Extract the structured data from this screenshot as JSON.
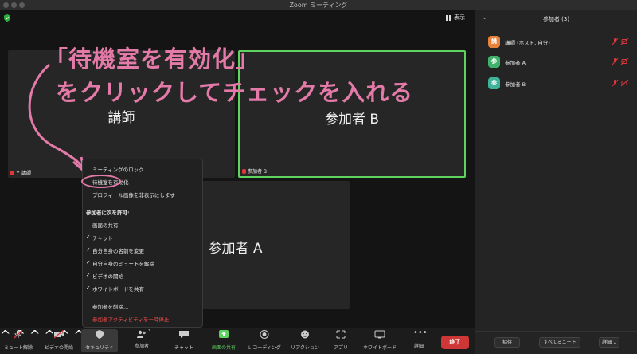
{
  "window": {
    "title": "Zoom ミーティング"
  },
  "main": {
    "view_label": "表示",
    "tiles": {
      "instructor": {
        "name": "講師",
        "label": "講師"
      },
      "participant_b": {
        "name": "参加者 B",
        "label": "参加者 B"
      },
      "participant_a": {
        "name": "参加者 A"
      }
    }
  },
  "annotation": {
    "line1": "「待機室を有効化」",
    "line2": "をクリックしてチェックを入れる",
    "color": "#e37aa8"
  },
  "security_menu": {
    "lock": "ミーティングのロック",
    "waiting_room": "待機室を有効化",
    "hide_profile": "プロフィール画像を非表示にします",
    "allow_heading": "参加者に次を許可:",
    "options": [
      {
        "label": "画面の共有",
        "checked": false
      },
      {
        "label": "チャット",
        "checked": true
      },
      {
        "label": "自分自身の名前を変更",
        "checked": true
      },
      {
        "label": "自分自身のミュートを解除",
        "checked": true
      },
      {
        "label": "ビデオの開始",
        "checked": true
      },
      {
        "label": "ホワイトボードを共有",
        "checked": true
      }
    ],
    "check_mark": "✓",
    "remove": "参加者を削除...",
    "suspend": "参加者アクティビティを一時停止"
  },
  "toolbar": {
    "unmute": "ミュート解除",
    "start_video": "ビデオの開始",
    "security": "セキュリティ",
    "participants": "参加者",
    "participants_count": "3",
    "chat": "チャット",
    "share": "画面の共有",
    "record": "レコーディング",
    "reactions": "リアクション",
    "apps": "アプリ",
    "whiteboard": "ホワイトボード",
    "more": "詳細",
    "end": "終了",
    "share_color": "#5fd35f",
    "end_color": "#cf3736"
  },
  "panel": {
    "title": "参加者 (3)",
    "participants": [
      {
        "avatar": "講",
        "name": "講師 (ホスト, 自分)",
        "color": "#e8823a"
      },
      {
        "avatar": "参",
        "name": "参加者 A",
        "color": "#3fb36b"
      },
      {
        "avatar": "参",
        "name": "参加者 B",
        "color": "#3fb39a"
      }
    ],
    "invite": "招待",
    "mute_all": "すべてミュート",
    "more": "詳細"
  }
}
